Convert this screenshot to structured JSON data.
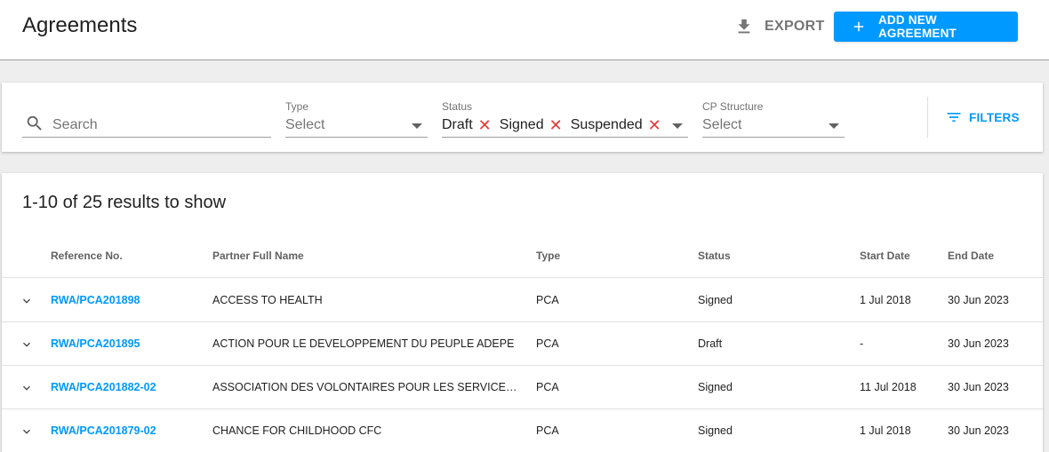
{
  "header": {
    "title": "Agreements",
    "export_label": "EXPORT",
    "add_label": "ADD NEW AGREEMENT"
  },
  "filters": {
    "search": {
      "placeholder": "Search"
    },
    "type": {
      "label": "Type",
      "value": "Select"
    },
    "status": {
      "label": "Status",
      "chips": [
        "Draft",
        "Signed",
        "Suspended"
      ]
    },
    "cp_structure": {
      "label": "CP Structure",
      "value": "Select"
    },
    "filters_label": "FILTERS"
  },
  "results": {
    "summary": "1-10 of 25 results to show",
    "columns": [
      "Reference No.",
      "Partner Full Name",
      "Type",
      "Status",
      "Start Date",
      "End Date"
    ],
    "rows": [
      {
        "ref": "RWA/PCA201898",
        "partner": "ACCESS TO HEALTH",
        "type": "PCA",
        "status": "Signed",
        "start": "1 Jul 2018",
        "end": "30 Jun 2023"
      },
      {
        "ref": "RWA/PCA201895",
        "partner": "ACTION POUR LE DEVELOPPEMENT DU PEUPLE ADEPE",
        "type": "PCA",
        "status": "Draft",
        "start": "-",
        "end": "30 Jun 2023"
      },
      {
        "ref": "RWA/PCA201882-02",
        "partner": "ASSOCIATION DES VOLONTAIRES POUR LES SERVICES IN…",
        "type": "PCA",
        "status": "Signed",
        "start": "11 Jul 2018",
        "end": "30 Jun 2023"
      },
      {
        "ref": "RWA/PCA201879-02",
        "partner": "CHANCE FOR CHILDHOOD CFC",
        "type": "PCA",
        "status": "Signed",
        "start": "1 Jul 2018",
        "end": "30 Jun 2023"
      }
    ]
  },
  "icons": {
    "export": "download-icon",
    "add": "plus-icon",
    "search": "search-icon",
    "filters": "filter-list-icon",
    "expand": "chevron-down-icon",
    "remove_chip": "close-icon"
  },
  "colors": {
    "accent": "#0099ff",
    "chip_remove": "#e53935",
    "background": "#eeeeee"
  }
}
